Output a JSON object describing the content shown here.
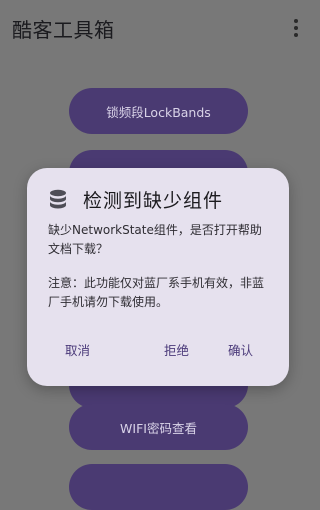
{
  "app": {
    "title": "酷客工具箱"
  },
  "buttons": {
    "lockbands": "锁频段LockBands",
    "wifi_password": "WIFI密码查看"
  },
  "dialog": {
    "title": "检测到缺少组件",
    "message_1": "缺少NetworkState组件，是否打开帮助文档下载？",
    "message_2": "注意：此功能仅对蓝厂系手机有效，非蓝厂手机请勿下载使用。",
    "cancel": "取消",
    "reject": "拒绝",
    "confirm": "确认"
  },
  "colors": {
    "scrim_background": "#787878",
    "button_fill": "#4a3a72",
    "dialog_surface": "#e6e1ee",
    "accent_text": "#4b3a7a"
  },
  "icons": {
    "dialog": "database-icon",
    "overflow": "more-vert-icon"
  }
}
